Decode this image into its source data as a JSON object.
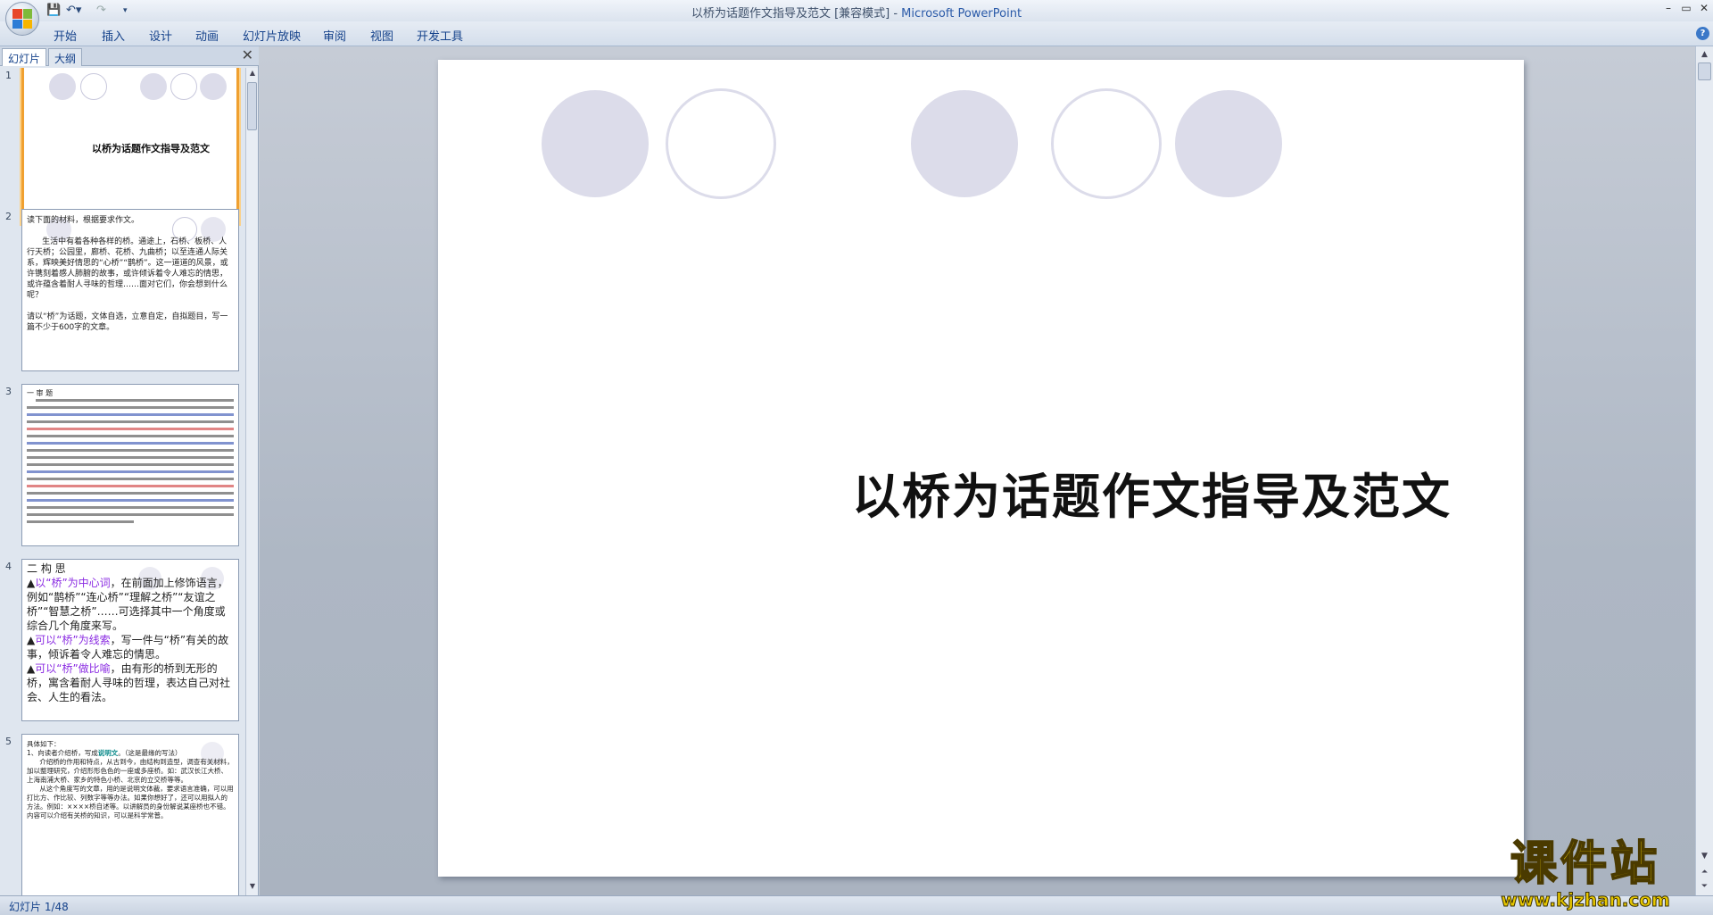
{
  "window": {
    "title_doc": "以桥为话题作文指导及范文 [兼容模式] - ",
    "title_app": "Microsoft PowerPoint"
  },
  "quick_access": {
    "save_icon": "save-icon",
    "undo_icon": "undo-icon",
    "redo_icon": "redo-icon",
    "customize_icon": "customize-quick-access-icon"
  },
  "ribbon": {
    "tabs": [
      "开始",
      "插入",
      "设计",
      "动画",
      "幻灯片放映",
      "审阅",
      "视图",
      "开发工具"
    ],
    "help_label": "?"
  },
  "pane": {
    "tab_slides": "幻灯片",
    "tab_outline": "大纲",
    "close_label": "✕"
  },
  "thumbnails": [
    {
      "num": "1",
      "title": "以桥为话题作文指导及范文"
    },
    {
      "num": "2",
      "text": "读下面的材料，根据要求作文。\n\n      生活中有着各种各样的桥。通途上，石桥、板桥、人行天桥；公园里，廊桥、花桥、九曲桥；以至连通人际关系，辉映美好情思的“心桥”“鹊桥”。这一道道的风景，或许镌刻着感人肺腑的故事，或许倾诉着令人难忘的情思，或许蕴含着耐人寻味的哲理……面对它们，你会想到什么呢？\n\n请以“桥”为话题，文体自选，立意自定，自拟题目，写一篇不少于600字的文章。"
    },
    {
      "num": "3",
      "text": "一 审 题"
    },
    {
      "num": "4",
      "line1": "二 构 思",
      "line2a": "▲",
      "line2b": "以“桥”为中心词",
      "line2c": "，在前面加上修饰语言，例如“鹊桥”“连心桥”“理解之桥”“友谊之桥”“智慧之桥”……可选择其中一个角度或综合几个角度来写。",
      "line3a": "▲",
      "line3b": "可以“桥”为线索",
      "line3c": "，写一件与“桥”有关的故事，倾诉着令人难忘的情思。",
      "line4a": "▲",
      "line4b": "可以“桥”做比喻",
      "line4c": "，由有形的桥到无形的桥，寓含着耐人寻味的哲理，表达自己对社会、人生的看法。"
    },
    {
      "num": "5",
      "head": "具体如下：",
      "l1a": "1、向读者介绍桥，写成",
      "l1b": "说明文",
      "l1c": "。（这是最缘的写法）",
      "body": "      介绍桥的作用和特点，从古到今，由结构到造型，调查有关材料，加以整理研究，介绍形形色色的一座或多座桥。如：武汉长江大桥、上海南浦大桥、家乡的特色小桥、北京的立交桥等等。\n      从这个角度写的文章，用的是说明文体裁，要求语言准确，可以用打比方、作比较、列数字等等办法。如果你想好了，还可以用拟人的方法。例如：××××桥自述等。以讲解员的身份解说某座桥也不错。内容可以介绍有关桥的知识，可以是科学常普。"
    }
  ],
  "slide": {
    "title": "以桥为话题作文指导及范文"
  },
  "status": {
    "slide_counter": "幻灯片 1/48"
  },
  "watermark": {
    "text": "课件站",
    "url": "www.kjzhan.com"
  }
}
